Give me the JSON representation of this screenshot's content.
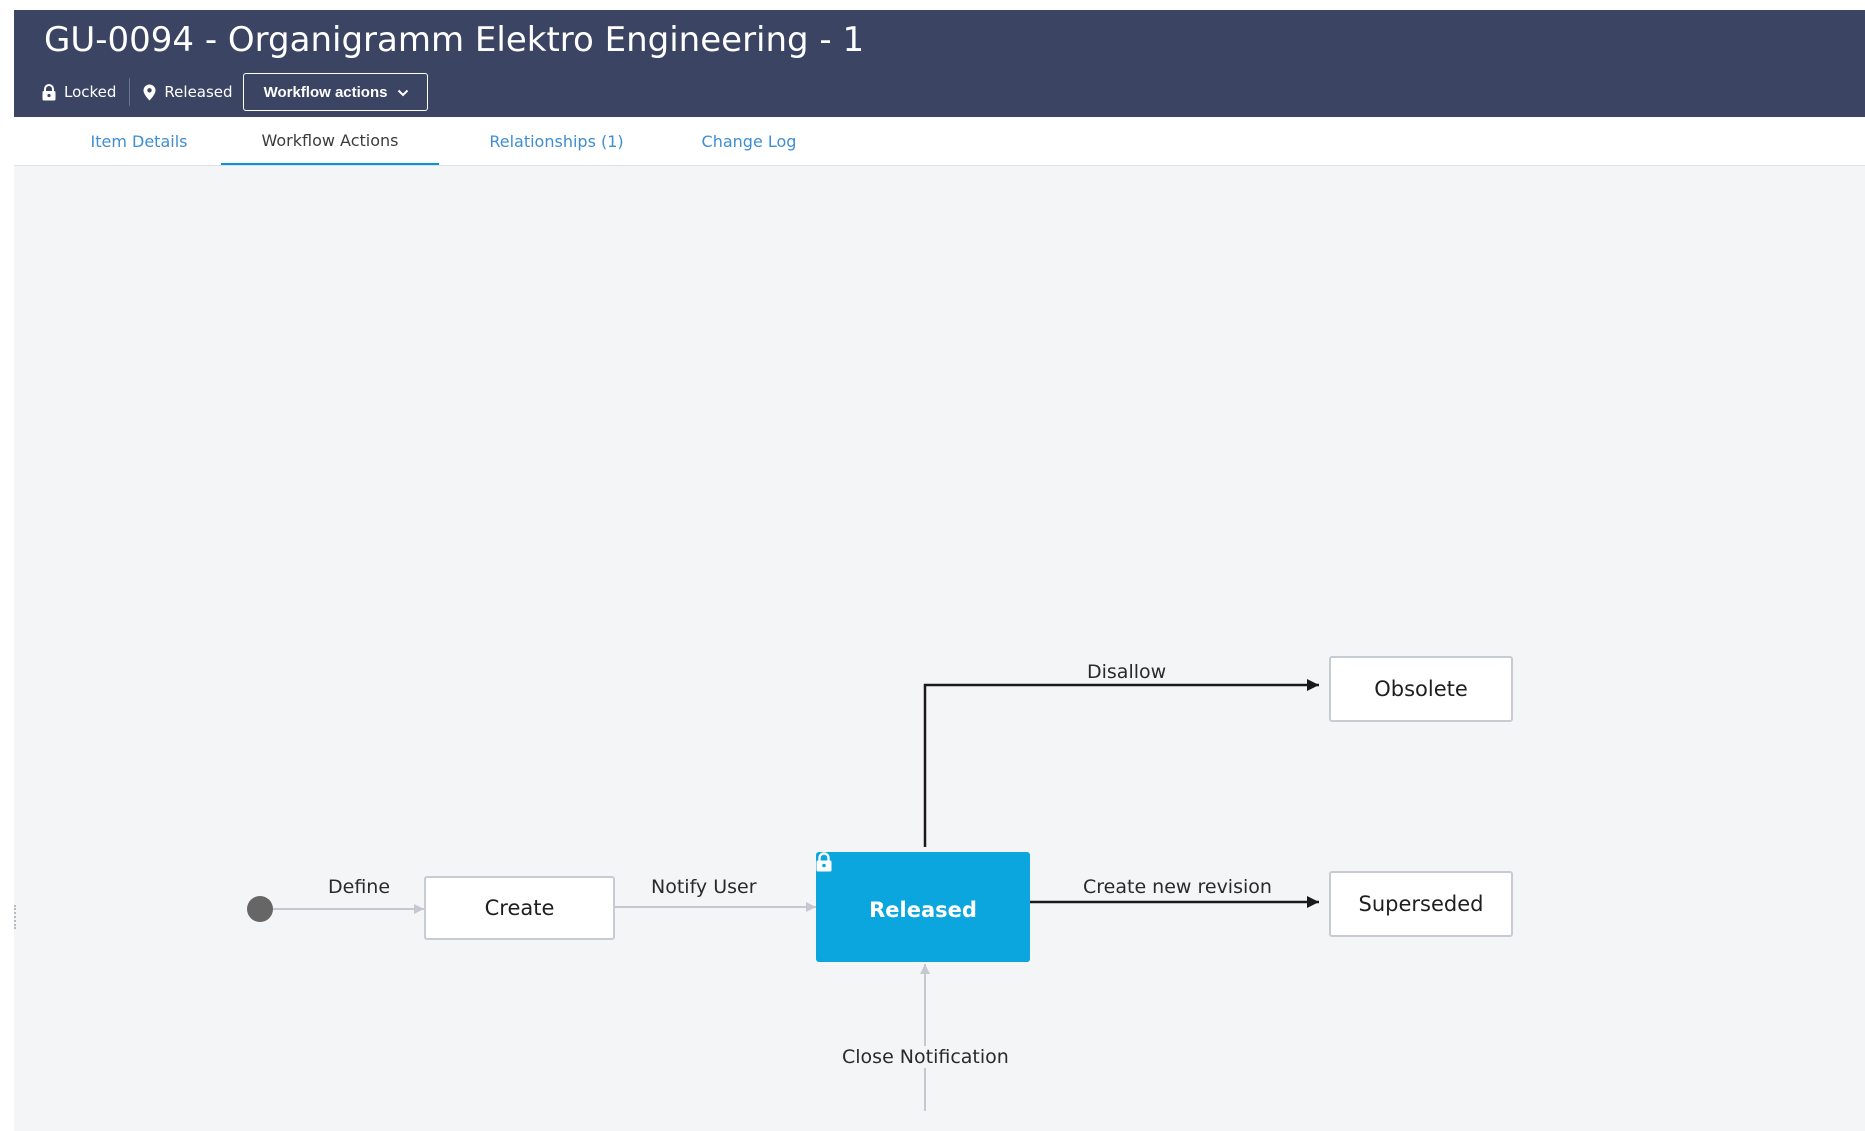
{
  "header": {
    "title": "GU-0094 - Organigramm Elektro Engineering - 1",
    "lock_status": "Locked",
    "lock_icon": "lock-icon",
    "workflow_state": "Released",
    "state_icon": "map-pin-icon",
    "workflow_actions_label": "Workflow actions",
    "dropdown_icon": "chevron-down-icon"
  },
  "tabs": [
    {
      "label": "Item Details",
      "active": false
    },
    {
      "label": "Workflow Actions",
      "active": true
    },
    {
      "label": "Relationships (1)",
      "active": false
    },
    {
      "label": "Change Log",
      "active": false
    }
  ],
  "workflow": {
    "states": {
      "create": "Create",
      "released": "Released",
      "obsolete": "Obsolete",
      "superseded": "Superseded"
    },
    "transitions": {
      "define": "Define",
      "notify_user": "Notify User",
      "disallow": "Disallow",
      "create_new_revision": "Create new revision",
      "close_notification": "Close Notification"
    },
    "current_state": "Released"
  },
  "colors": {
    "header_bg": "#3b4563",
    "accent": "#0aa6dd",
    "tab_link": "#3e8ed0",
    "canvas_bg": "#f4f5f7",
    "inactive_edge": "#c4c9d1",
    "active_edge": "#1a1a1a"
  }
}
